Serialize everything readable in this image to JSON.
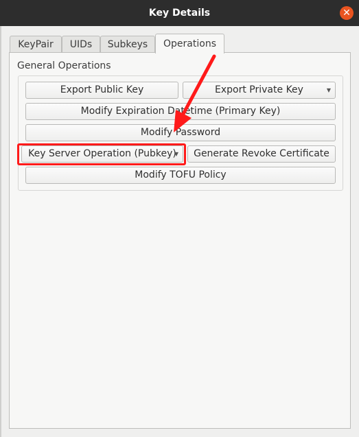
{
  "window": {
    "title": "Key Details"
  },
  "tabs": [
    "KeyPair",
    "UIDs",
    "Subkeys",
    "Operations"
  ],
  "active_tab": "Operations",
  "group": {
    "label": "General Operations",
    "buttons": {
      "export_public": "Export Public Key",
      "export_private": "Export Private Key",
      "modify_expiration": "Modify Expiration Datetime (Primary Key)",
      "modify_password": "Modify Password",
      "key_server": "Key Server Operation (Pubkey)",
      "revoke_cert": "Generate Revoke Certificate",
      "tofu_policy": "Modify TOFU Policy"
    }
  },
  "annotation_color": "#ff1a1a",
  "accent_close": "#e95420"
}
